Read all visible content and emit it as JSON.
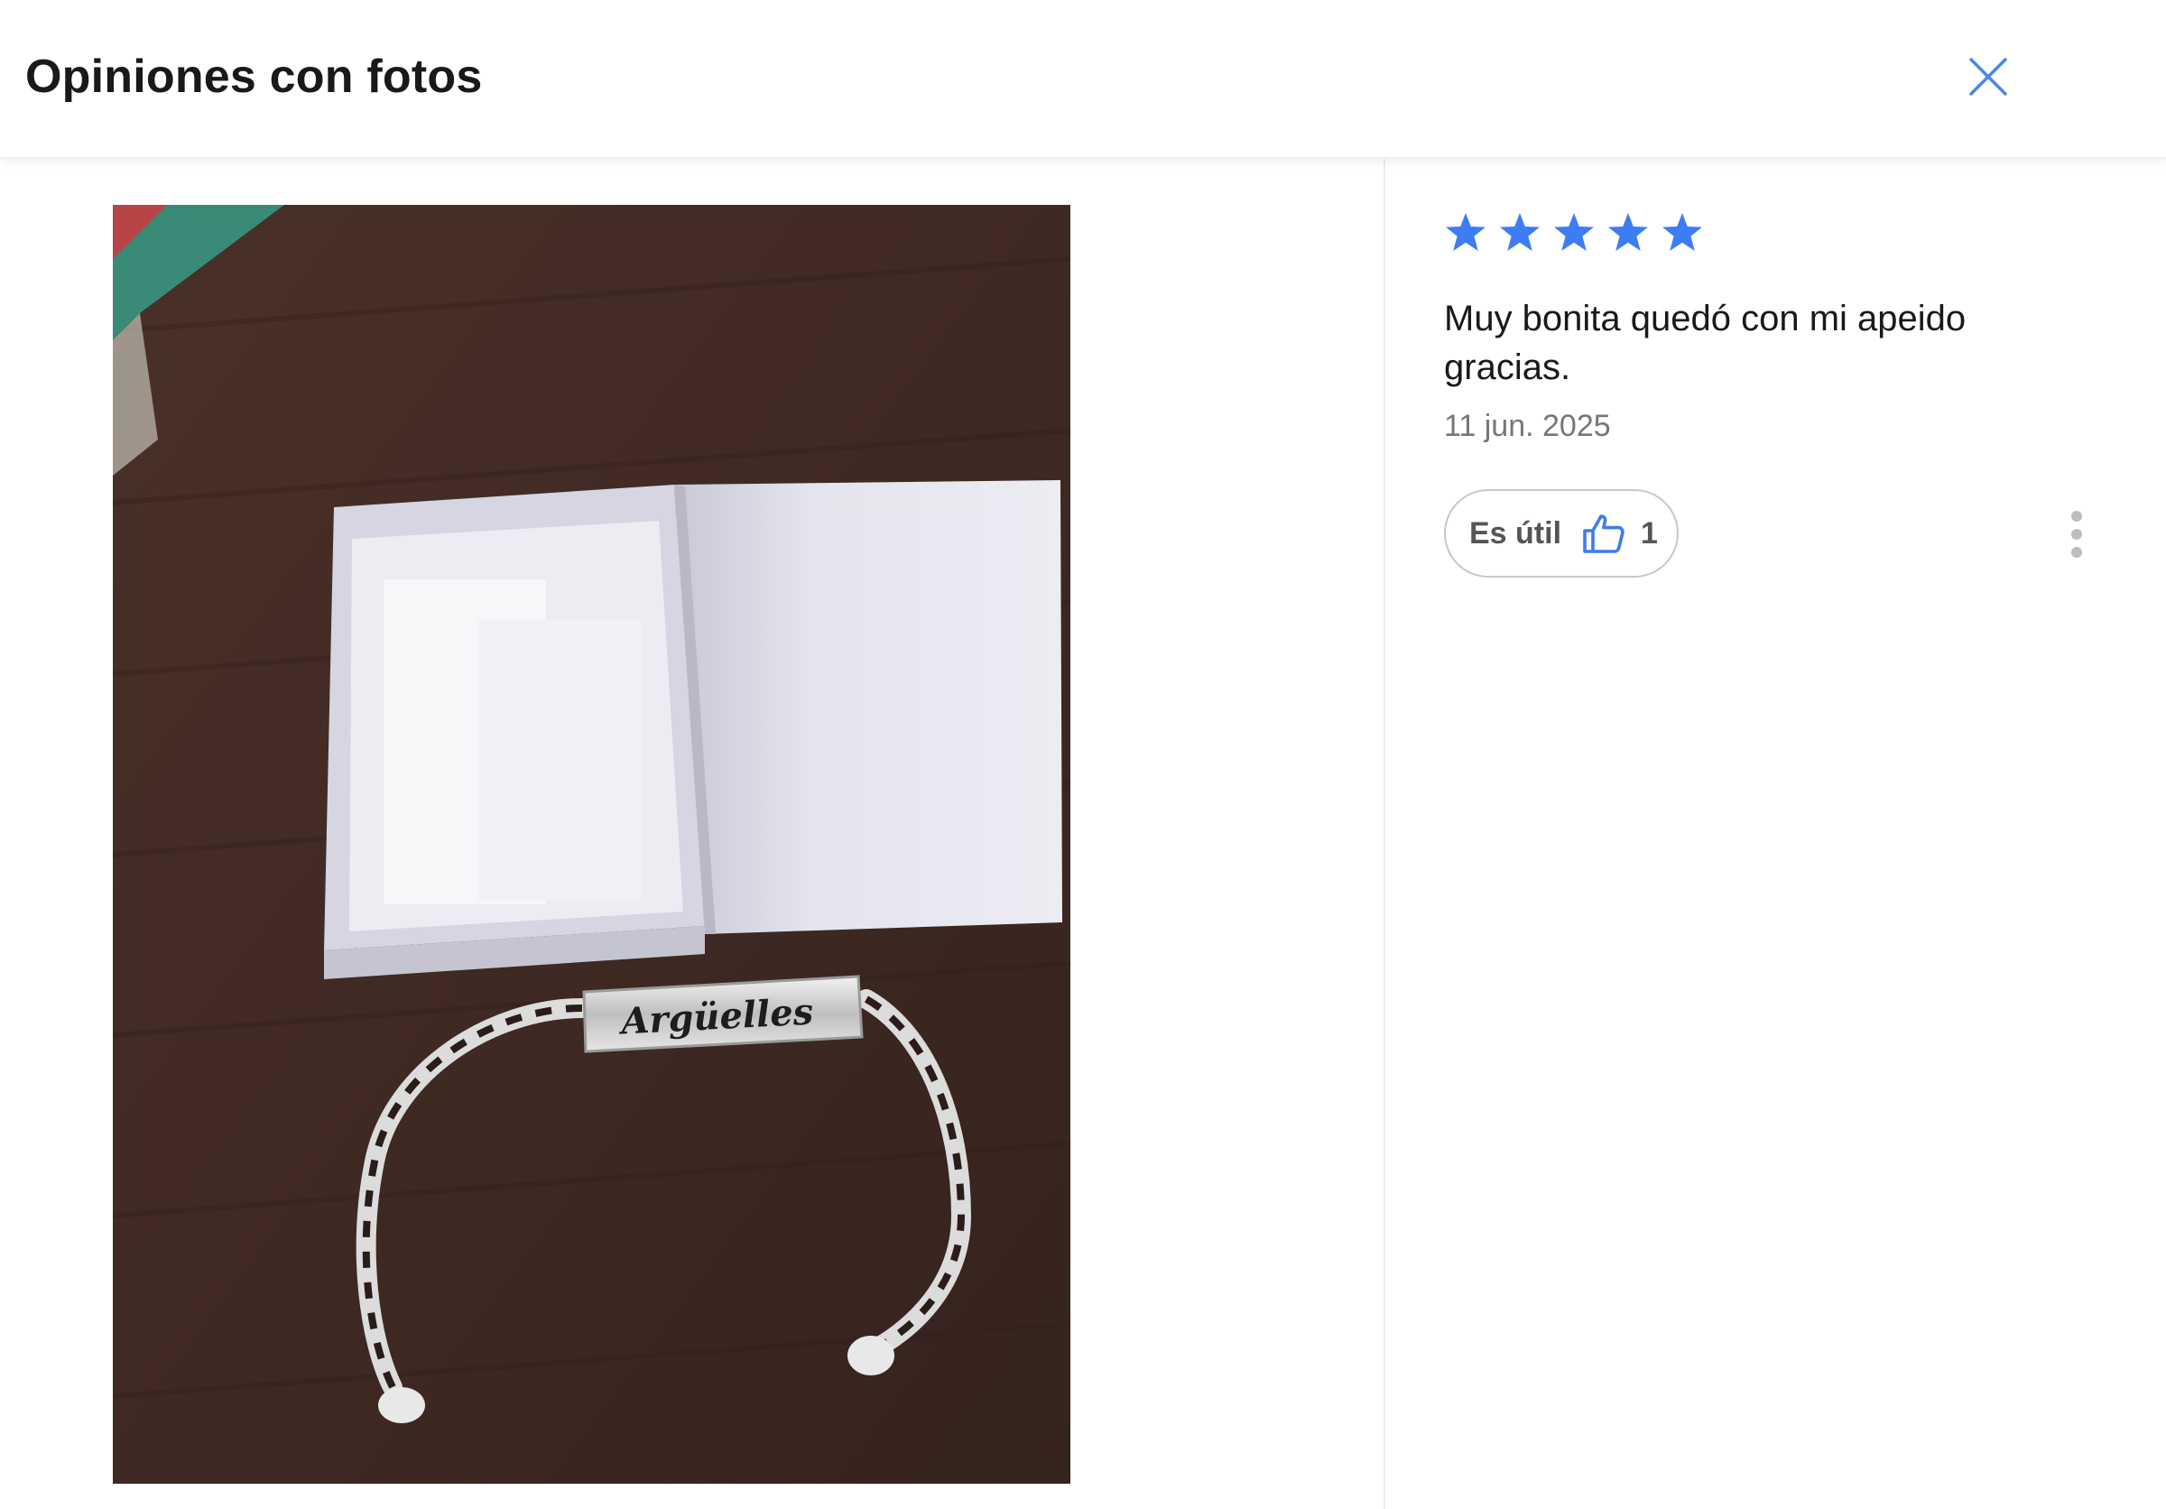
{
  "header": {
    "title": "Opiniones con fotos",
    "close_icon": "close-icon"
  },
  "photo": {
    "alt": "bracelet-photo",
    "engraving": "Argüelles"
  },
  "review": {
    "rating": 5,
    "max_rating": 5,
    "star_color": "#3D7CF2",
    "text": "Muy bonita quedó con mi apeido gracias.",
    "date": "11 jun. 2025",
    "useful_label": "Es útil",
    "useful_count": "1",
    "useful_icon": "thumbs-up-icon",
    "more_icon": "more-vertical-icon"
  }
}
